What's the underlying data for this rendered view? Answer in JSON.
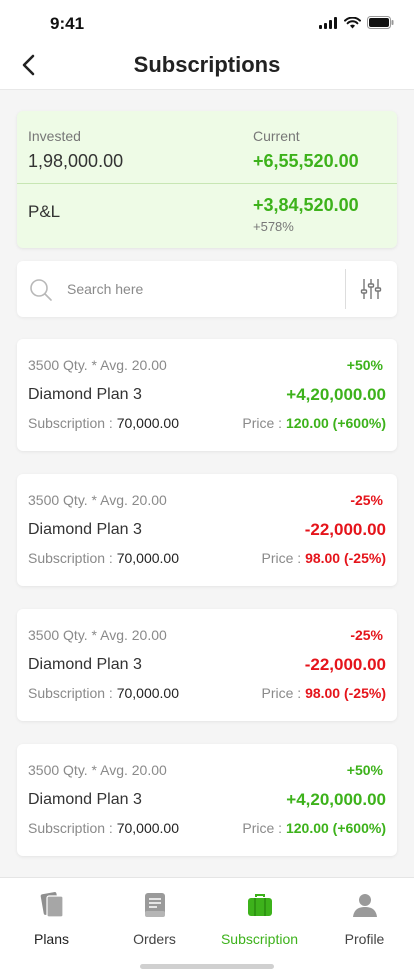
{
  "status_bar": {
    "time": "9:41"
  },
  "header": {
    "title": "Subscriptions"
  },
  "summary": {
    "invested_label": "Invested",
    "invested_value": "1,98,000.00",
    "current_label": "Current",
    "current_value": "+6,55,520.00",
    "pnl_label": "P&L",
    "pnl_value": "+3,84,520.00",
    "pnl_percent": "+578%"
  },
  "search": {
    "placeholder": "Search here"
  },
  "plans": [
    {
      "qty": "3500 Qty. * Avg. 20.00",
      "pct": "+50%",
      "name": "Diamond Plan 3",
      "amount": "+4,20,000.00",
      "sub_label": "Subscription : ",
      "sub_value": "70,000.00",
      "price_label": "Price : ",
      "price_value": "120.00 (+600%)",
      "trend": "up"
    },
    {
      "qty": "3500 Qty. * Avg. 20.00",
      "pct": "-25%",
      "name": "Diamond Plan 3",
      "amount": "-22,000.00",
      "sub_label": "Subscription : ",
      "sub_value": "70,000.00",
      "price_label": "Price : ",
      "price_value": "98.00 (-25%)",
      "trend": "down"
    },
    {
      "qty": "3500 Qty. * Avg. 20.00",
      "pct": "-25%",
      "name": "Diamond Plan 3",
      "amount": "-22,000.00",
      "sub_label": "Subscription : ",
      "sub_value": "70,000.00",
      "price_label": "Price : ",
      "price_value": "98.00 (-25%)",
      "trend": "down"
    },
    {
      "qty": "3500 Qty. * Avg. 20.00",
      "pct": "+50%",
      "name": "Diamond Plan 3",
      "amount": "+4,20,000.00",
      "sub_label": "Subscription : ",
      "sub_value": "70,000.00",
      "price_label": "Price : ",
      "price_value": "120.00 (+600%)",
      "trend": "up"
    }
  ],
  "tabs": [
    {
      "label": "Plans",
      "icon": "plans-icon",
      "active": false
    },
    {
      "label": "Orders",
      "icon": "orders-icon",
      "active": false
    },
    {
      "label": "Subscription",
      "icon": "briefcase-icon",
      "active": true
    },
    {
      "label": "Profile",
      "icon": "profile-icon",
      "active": false
    }
  ],
  "colors": {
    "accent": "#3db21b",
    "negative": "#e5141b",
    "summary_bg": "#eefbe6"
  }
}
